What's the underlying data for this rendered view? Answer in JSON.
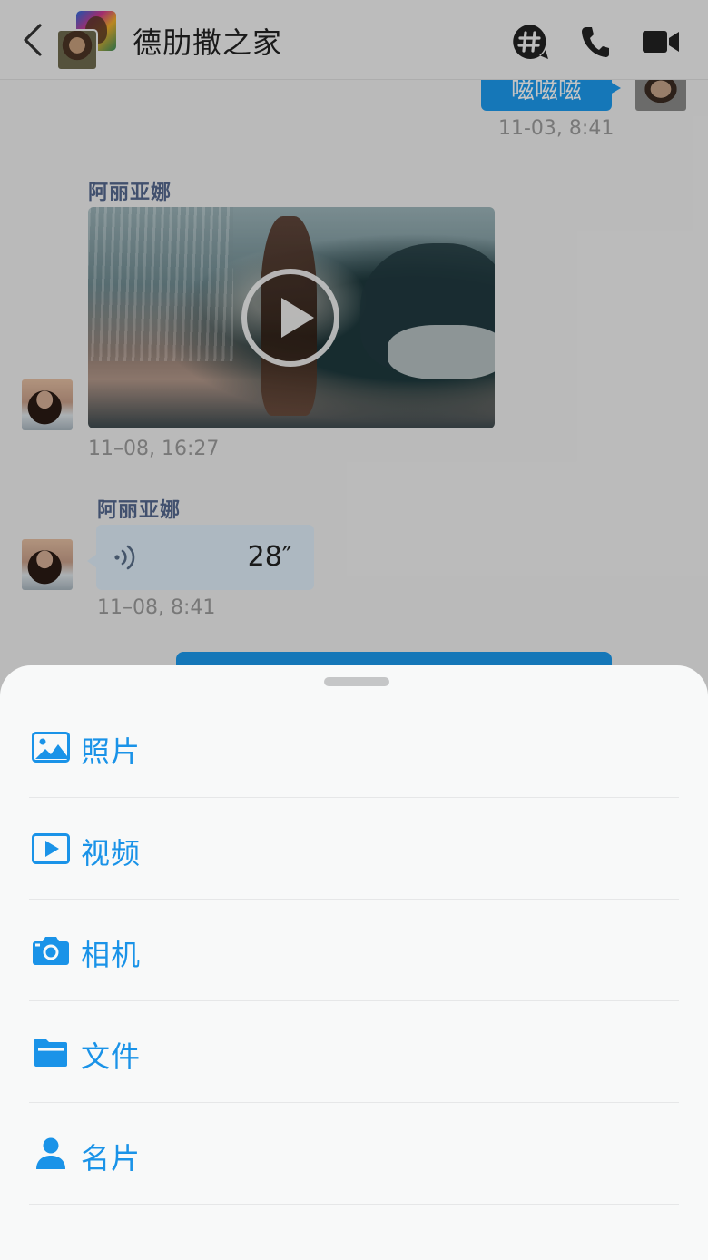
{
  "header": {
    "title": "德肋撒之家",
    "back_icon": "chevron-left-icon",
    "actions": [
      "hashtag-chat-icon",
      "phone-icon",
      "video-camera-icon"
    ]
  },
  "messages": {
    "outgoing_text": "嗞嗞嗞",
    "outgoing_time": "11-03, 8:41",
    "video": {
      "sender": "阿丽亚娜",
      "time": "11–08, 16:27"
    },
    "voice": {
      "sender": "阿丽亚娜",
      "duration": "28″",
      "time": "11–08, 8:41"
    }
  },
  "sheet": {
    "items": [
      {
        "label": "照片",
        "icon": "image-icon"
      },
      {
        "label": "视频",
        "icon": "video-file-icon"
      },
      {
        "label": "相机",
        "icon": "camera-icon"
      },
      {
        "label": "文件",
        "icon": "folder-icon"
      },
      {
        "label": "名片",
        "icon": "contact-card-icon"
      }
    ]
  },
  "colors": {
    "accent": "#1a93e8",
    "bubble_out": "#1c9bf0",
    "bubble_in": "#e1f0fb",
    "sender_name": "#55688f"
  }
}
